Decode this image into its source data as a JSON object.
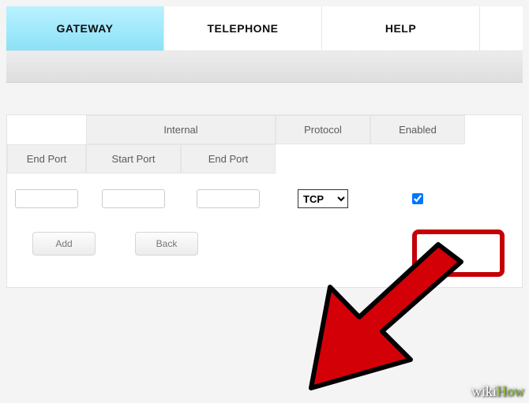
{
  "nav": {
    "tabs": [
      {
        "label": "GATEWAY",
        "active": true
      },
      {
        "label": "TELEPHONE",
        "active": false
      },
      {
        "label": "HELP",
        "active": false
      }
    ]
  },
  "table": {
    "group_internal": "Internal",
    "group_protocol": "Protocol",
    "group_enabled": "Enabled",
    "cols": {
      "end_port_ext": "End Port",
      "start_port": "Start Port",
      "end_port_int": "End Port"
    },
    "row": {
      "end_port_ext": "",
      "start_port": "",
      "end_port_int": "",
      "protocol": "TCP",
      "enabled": true
    }
  },
  "buttons": {
    "add": "Add",
    "back": "Back"
  },
  "watermark": {
    "wiki": "wiki",
    "how": "How"
  }
}
